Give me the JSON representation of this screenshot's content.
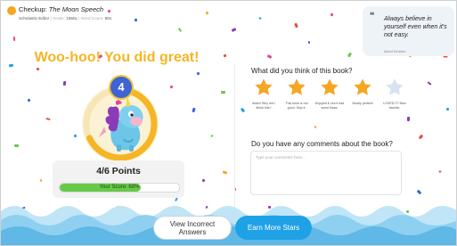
{
  "header": {
    "prefix": "Checkup: ",
    "book_title": "The Moon Speech",
    "publisher": "Scholastic Editor",
    "level_label": "Grade: ",
    "level_value": "1550L",
    "word_label": "Word Count: ",
    "word_value": "881"
  },
  "quote": {
    "text": "Always believe in yourself even when it's not easy.",
    "author": "Albert Einstein"
  },
  "result": {
    "headline": "Woo-hoo! You did great!",
    "stars_badge": "4",
    "points": "4/6 Points",
    "score_text": "Your Score: 68%",
    "score_fraction": 0.68
  },
  "rating": {
    "question": "What did you think of this book?",
    "selected": 4,
    "colors": {
      "on": "#f5a623",
      "off": "#d7e3f1"
    },
    "options": [
      {
        "label": "Awful! Why did I finish this?"
      },
      {
        "label": "This book is not good. Skip it."
      },
      {
        "label": "Enjoyed it, but it had some flaws."
      },
      {
        "label": "Nearly perfect!"
      },
      {
        "label": "LOVED IT! New favorite."
      }
    ]
  },
  "comments": {
    "question": "Do you have any comments about the book?",
    "placeholder": "Type your comments here...",
    "value": ""
  },
  "actions": {
    "view_incorrect_line1": "View Incorrect",
    "view_incorrect_line2": "Answers",
    "earn_more": "Earn More Stars"
  }
}
